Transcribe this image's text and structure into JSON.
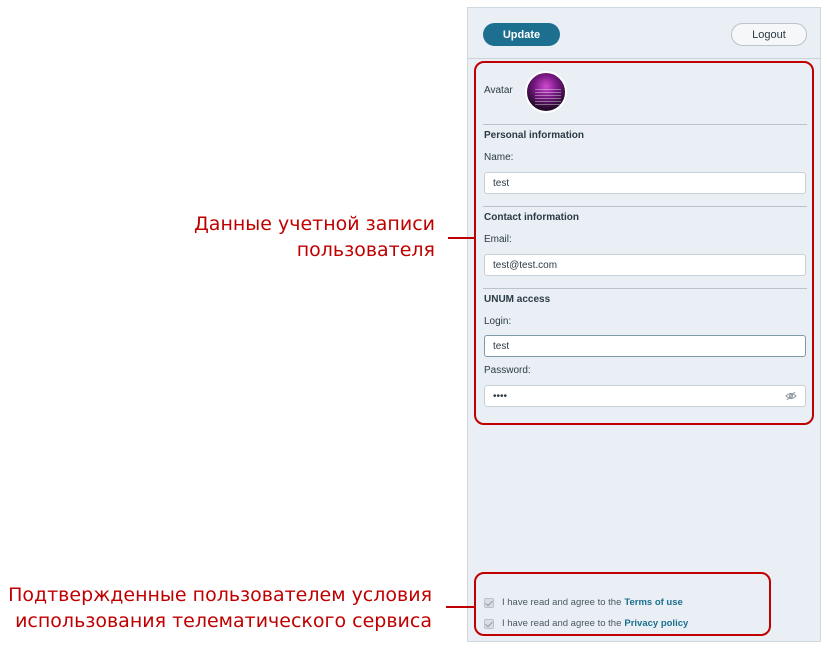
{
  "toolbar": {
    "update_label": "Update",
    "logout_label": "Logout"
  },
  "avatar": {
    "label": "Avatar"
  },
  "personal": {
    "title": "Personal information",
    "name_label": "Name:",
    "name_value": "test"
  },
  "contact": {
    "title": "Contact information",
    "email_label": "Email:",
    "email_value": "test@test.com"
  },
  "access": {
    "title": "UNUM access",
    "login_label": "Login:",
    "login_value": "test",
    "password_label": "Password:",
    "password_value": "••••"
  },
  "terms": {
    "prefix": "I have read and agree to the",
    "terms_link": "Terms of use",
    "privacy_link": "Privacy policy"
  },
  "annotations": {
    "account_line1": "Данные учетной записи",
    "account_line2": "пользователя",
    "terms_line1": "Подтвержденные пользователем условия",
    "terms_line2": "использования телематического сервиса"
  },
  "colors": {
    "accent": "#1d6f8f",
    "annotation": "#c00000",
    "panel_bg": "#e9eff4"
  },
  "icons": {
    "password_toggle": "eye-off-icon",
    "checkbox": "check-icon"
  }
}
